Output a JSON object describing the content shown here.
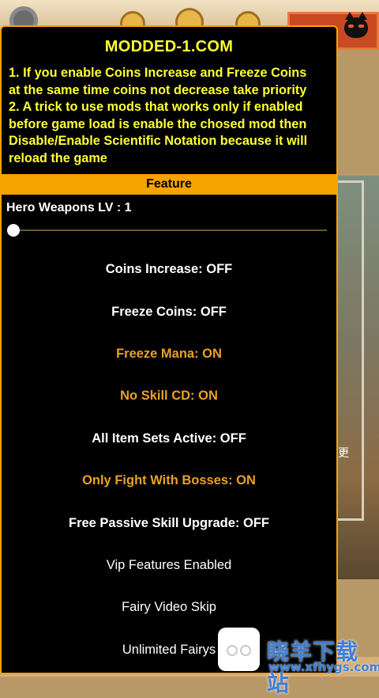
{
  "menu": {
    "title": "MODDED-1.COM",
    "notes": [
      "1. If you enable Coins Increase and Freeze Coins",
      "at the same time coins not decrease take priority",
      "2. A trick to use mods that works only if enabled",
      "before game load is enable the chosed mod then",
      "Disable/Enable Scientific Notation because it will",
      "reload the game"
    ],
    "section_label": "Feature",
    "slider": {
      "label": "Hero Weapons LV : 1",
      "value": 1
    },
    "options": [
      {
        "label": "Coins Increase: OFF",
        "state": "off"
      },
      {
        "label": "Freeze Coins: OFF",
        "state": "off"
      },
      {
        "label": "Freeze Mana: ON",
        "state": "on"
      },
      {
        "label": "No Skill CD: ON",
        "state": "on"
      },
      {
        "label": "All Item Sets Active: OFF",
        "state": "off"
      },
      {
        "label": "Only Fight With Bosses: ON",
        "state": "on"
      },
      {
        "label": "Free Passive Skill Upgrade: OFF",
        "state": "off"
      },
      {
        "label": "Vip Features Enabled",
        "state": "button"
      },
      {
        "label": "Fairy Video Skip",
        "state": "button"
      },
      {
        "label": "Unlimited Fairys",
        "state": "button"
      }
    ]
  },
  "background": {
    "side_glyph": "更"
  },
  "watermark": {
    "title": "晓羊下载站",
    "url": "www.xfhygs.com"
  },
  "colors": {
    "accent": "#f7a300",
    "note_text": "#ffff33",
    "on_text": "#e8a125",
    "off_text": "#ffffff",
    "watermark": "#3e7fd8"
  }
}
